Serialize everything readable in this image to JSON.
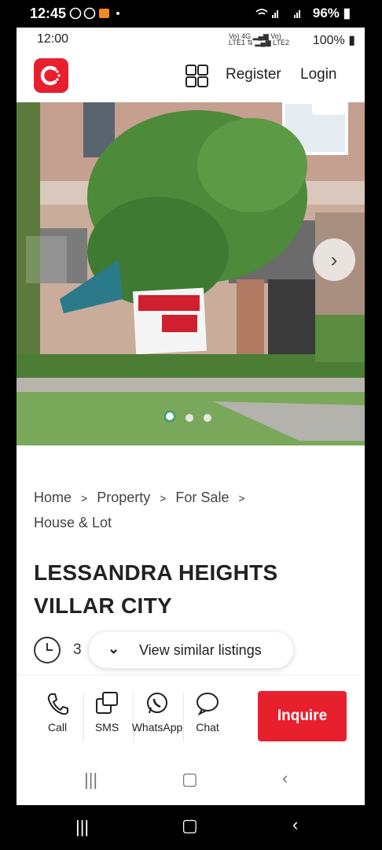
{
  "outer_status": {
    "time": "12:45",
    "battery": "96%"
  },
  "inner_status": {
    "time": "12:00",
    "battery": "100%",
    "net1": "Vo) 4G",
    "net2": "LTE1 LTE2"
  },
  "header": {
    "register": "Register",
    "login": "Login"
  },
  "photo": {
    "slides": 3,
    "active_slide": 1
  },
  "breadcrumb": [
    "Home",
    "Property",
    "For Sale",
    "House & Lot"
  ],
  "title": "LESSANDRA HEIGHTS VILLAR CITY",
  "listing_meta": {
    "clock_value": "3"
  },
  "similar": {
    "label": "View similar listings"
  },
  "actions": {
    "call": "Call",
    "sms": "SMS",
    "whatsapp": "WhatsApp",
    "chat": "Chat",
    "inquire": "Inquire"
  },
  "colors": {
    "brand": "#e8202e",
    "dot_active": "#2b9a7b"
  }
}
